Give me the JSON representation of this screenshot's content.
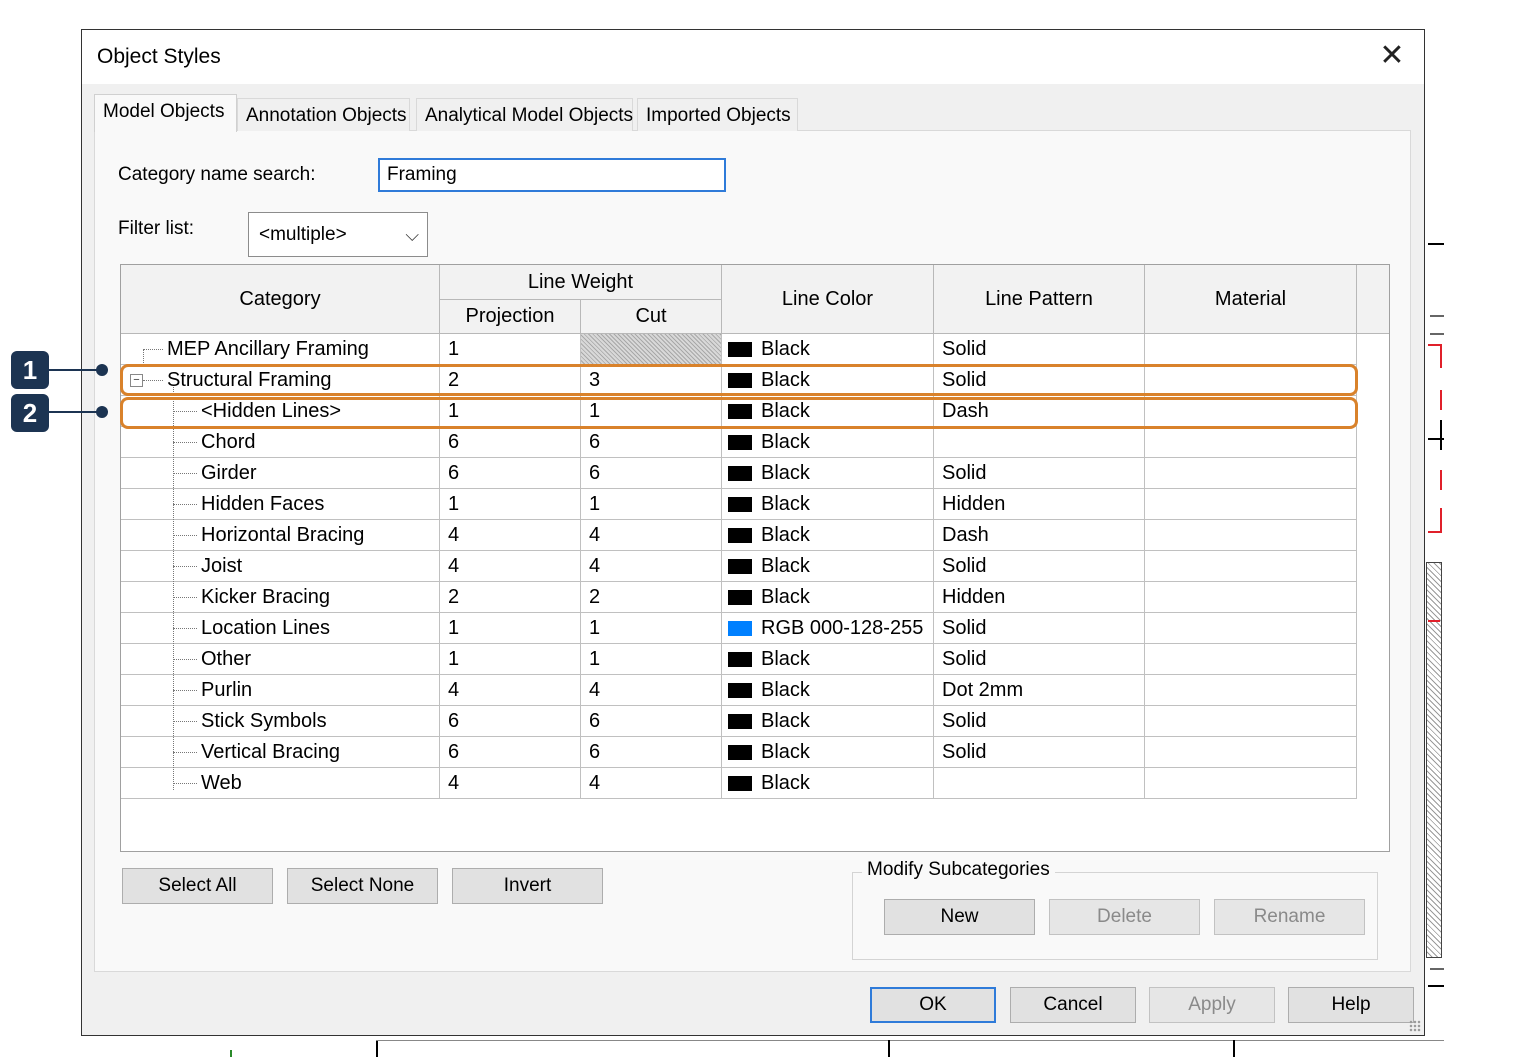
{
  "window": {
    "title": "Object Styles"
  },
  "tabs": [
    {
      "label": "Model Objects",
      "active": true
    },
    {
      "label": "Annotation Objects",
      "active": false
    },
    {
      "label": "Analytical Model Objects",
      "active": false
    },
    {
      "label": "Imported Objects",
      "active": false
    }
  ],
  "search": {
    "label": "Category name search:",
    "value": "Framing"
  },
  "filter": {
    "label": "Filter list:",
    "value": "<multiple>"
  },
  "table": {
    "headers": {
      "category": "Category",
      "line_weight": "Line Weight",
      "projection": "Projection",
      "cut": "Cut",
      "line_color": "Line Color",
      "line_pattern": "Line Pattern",
      "material": "Material"
    },
    "rows": [
      {
        "category": "MEP Ancillary Framing",
        "projection": "1",
        "cut": "",
        "color": "Black",
        "swatch": "#000000",
        "pattern": "Solid",
        "material": "",
        "level": 0
      },
      {
        "category": "Structural Framing",
        "projection": "2",
        "cut": "3",
        "color": "Black",
        "swatch": "#000000",
        "pattern": "Solid",
        "material": "",
        "level": 0
      },
      {
        "category": "<Hidden Lines>",
        "projection": "1",
        "cut": "1",
        "color": "Black",
        "swatch": "#000000",
        "pattern": "Dash",
        "material": "",
        "level": 1
      },
      {
        "category": "Chord",
        "projection": "6",
        "cut": "6",
        "color": "Black",
        "swatch": "#000000",
        "pattern": "",
        "material": "",
        "level": 1
      },
      {
        "category": "Girder",
        "projection": "6",
        "cut": "6",
        "color": "Black",
        "swatch": "#000000",
        "pattern": "Solid",
        "material": "",
        "level": 1
      },
      {
        "category": "Hidden Faces",
        "projection": "1",
        "cut": "1",
        "color": "Black",
        "swatch": "#000000",
        "pattern": "Hidden",
        "material": "",
        "level": 1
      },
      {
        "category": "Horizontal Bracing",
        "projection": "4",
        "cut": "4",
        "color": "Black",
        "swatch": "#000000",
        "pattern": "Dash",
        "material": "",
        "level": 1
      },
      {
        "category": "Joist",
        "projection": "4",
        "cut": "4",
        "color": "Black",
        "swatch": "#000000",
        "pattern": "Solid",
        "material": "",
        "level": 1
      },
      {
        "category": "Kicker Bracing",
        "projection": "2",
        "cut": "2",
        "color": "Black",
        "swatch": "#000000",
        "pattern": "Hidden",
        "material": "",
        "level": 1
      },
      {
        "category": "Location Lines",
        "projection": "1",
        "cut": "1",
        "color": "RGB 000-128-255",
        "swatch": "#0080ff",
        "pattern": "Solid",
        "material": "",
        "level": 1
      },
      {
        "category": "Other",
        "projection": "1",
        "cut": "1",
        "color": "Black",
        "swatch": "#000000",
        "pattern": "Solid",
        "material": "",
        "level": 1
      },
      {
        "category": "Purlin",
        "projection": "4",
        "cut": "4",
        "color": "Black",
        "swatch": "#000000",
        "pattern": "Dot 2mm",
        "material": "",
        "level": 1
      },
      {
        "category": "Stick Symbols",
        "projection": "6",
        "cut": "6",
        "color": "Black",
        "swatch": "#000000",
        "pattern": "Solid",
        "material": "",
        "level": 1
      },
      {
        "category": "Vertical Bracing",
        "projection": "6",
        "cut": "6",
        "color": "Black",
        "swatch": "#000000",
        "pattern": "Solid",
        "material": "",
        "level": 1
      },
      {
        "category": "Web",
        "projection": "4",
        "cut": "4",
        "color": "Black",
        "swatch": "#000000",
        "pattern": "",
        "material": "",
        "level": 1
      }
    ]
  },
  "selection_buttons": {
    "select_all": "Select All",
    "select_none": "Select None",
    "invert": "Invert"
  },
  "modify_subcategories": {
    "label": "Modify Subcategories",
    "new": "New",
    "delete": "Delete",
    "rename": "Rename"
  },
  "footer_buttons": {
    "ok": "OK",
    "cancel": "Cancel",
    "apply": "Apply",
    "help": "Help"
  },
  "callouts": [
    {
      "label": "1"
    },
    {
      "label": "2"
    }
  ],
  "colors": {
    "callout": "#1c3452",
    "highlight": "#d9822b",
    "accent": "#2f7bd9"
  }
}
